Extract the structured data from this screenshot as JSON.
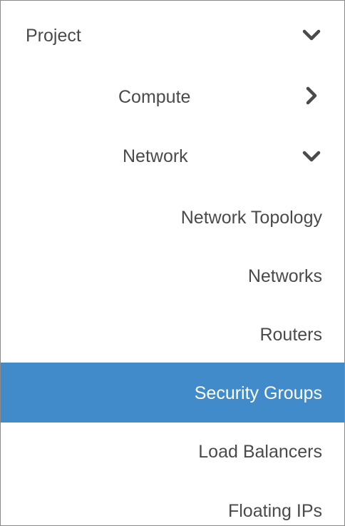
{
  "sidebar": {
    "section": {
      "label": "Project",
      "state": "expanded",
      "icon": "chevron-down-icon"
    },
    "panels": [
      {
        "label": "Compute",
        "state": "collapsed",
        "icon": "chevron-right-icon"
      },
      {
        "label": "Network",
        "state": "expanded",
        "icon": "chevron-down-icon"
      }
    ],
    "network_items": [
      {
        "label": "Network Topology",
        "active": false
      },
      {
        "label": "Networks",
        "active": false
      },
      {
        "label": "Routers",
        "active": false
      },
      {
        "label": "Security Groups",
        "active": true
      },
      {
        "label": "Load Balancers",
        "active": false
      },
      {
        "label": "Floating IPs",
        "active": false
      }
    ]
  },
  "colors": {
    "text": "#4a4a4a",
    "active_background": "#428bca",
    "active_text": "#ffffff",
    "border": "#8a8a8a"
  }
}
